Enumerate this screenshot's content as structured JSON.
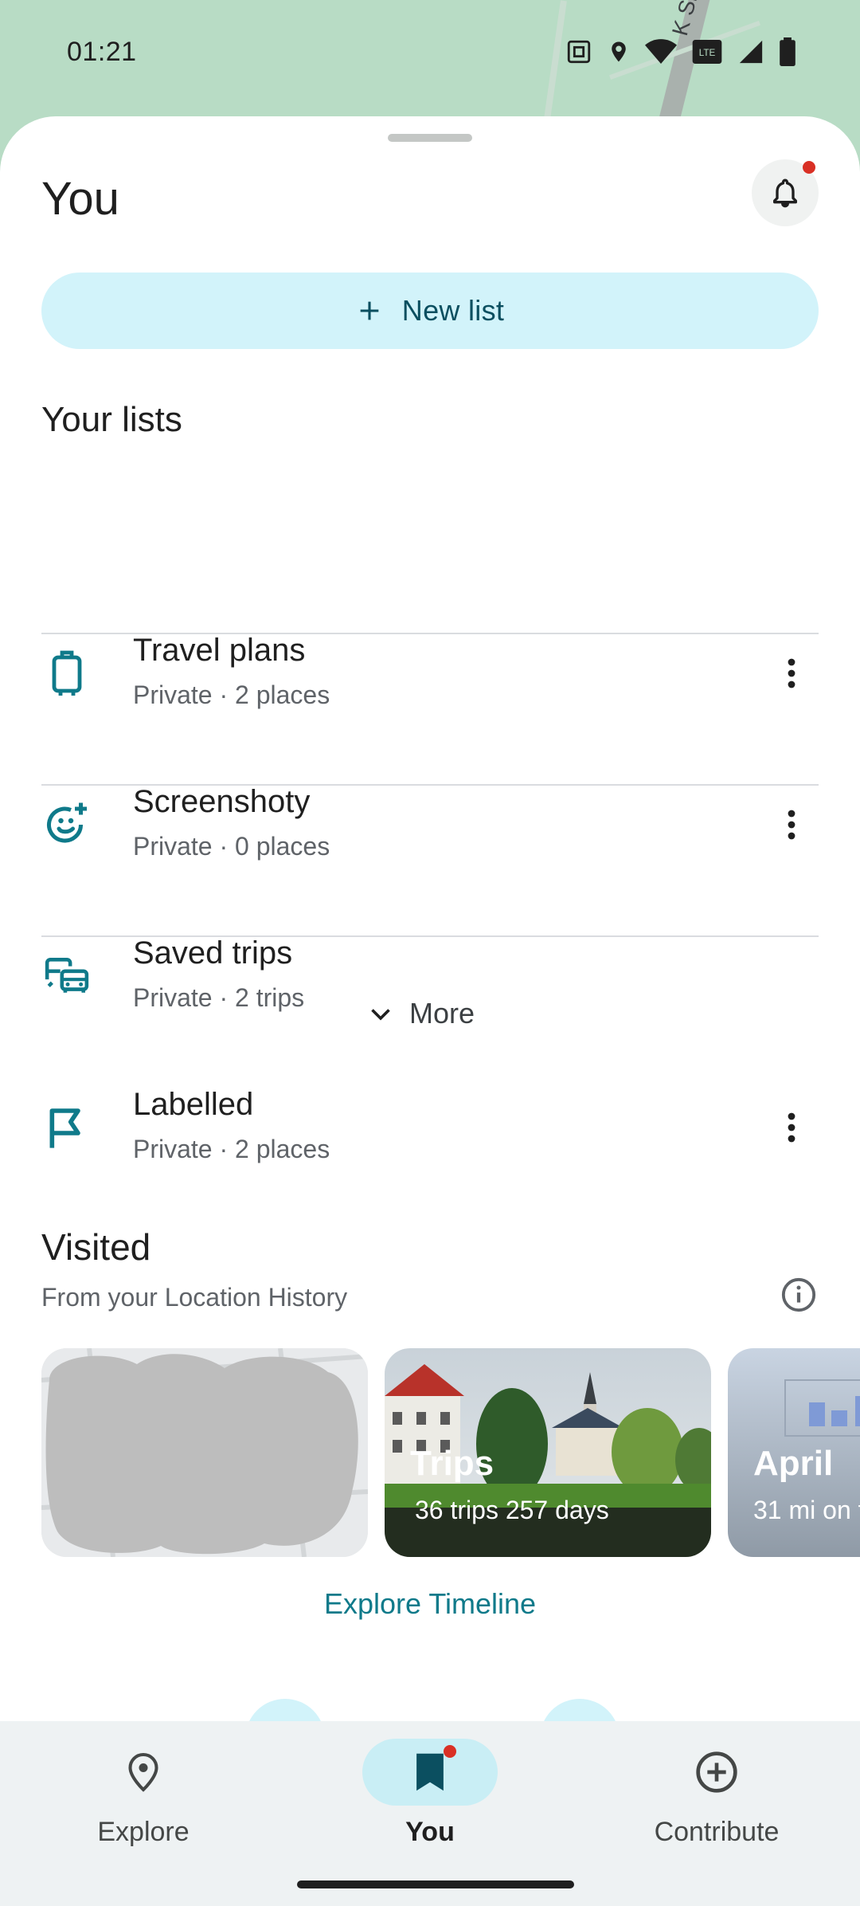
{
  "status_bar": {
    "time": "01:21"
  },
  "map": {
    "street_label": "K Sinor"
  },
  "header": {
    "title": "You"
  },
  "actions": {
    "new_list_label": "New list"
  },
  "lists": {
    "title": "Your lists",
    "items": [
      {
        "name": "Travel plans",
        "subtitle": "Private · 2 places",
        "icon": "luggage-icon"
      },
      {
        "name": "Screenshoty",
        "subtitle": "Private · 0 places",
        "icon": "emoji-add-icon"
      },
      {
        "name": "Saved trips",
        "subtitle": "Private · 2 trips",
        "icon": "commute-icon"
      },
      {
        "name": "Labelled",
        "subtitle": "Private · 2 places",
        "icon": "flag-icon"
      }
    ],
    "more_label": "More"
  },
  "visited": {
    "title": "Visited",
    "subtitle": "From your Location History",
    "cards": [
      {
        "title": "",
        "subtitle": ""
      },
      {
        "title": "Trips",
        "subtitle": "36 trips  257 days"
      },
      {
        "title": "April",
        "subtitle": "31 mi on t"
      }
    ],
    "explore_timeline_label": "Explore Timeline"
  },
  "bottom_nav": {
    "items": [
      {
        "label": "Explore",
        "icon": "location-pin-icon",
        "active": false
      },
      {
        "label": "You",
        "icon": "bookmark-icon",
        "active": true
      },
      {
        "label": "Contribute",
        "icon": "add-circle-icon",
        "active": false
      }
    ]
  },
  "colors": {
    "accent": "#0f7a8a",
    "new_list_bg": "#d2f3fa",
    "badge": "#d93025"
  }
}
